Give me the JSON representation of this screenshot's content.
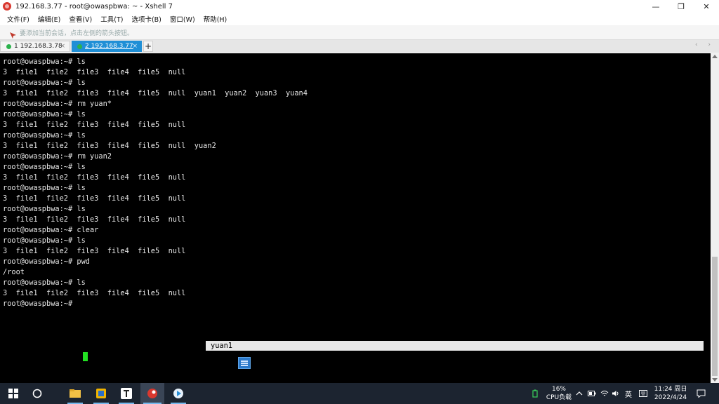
{
  "window": {
    "title": "192.168.3.77 - root@owaspbwa: ~ - Xshell 7",
    "controls": {
      "minimize": "—",
      "restore": "❐",
      "close": "✕"
    }
  },
  "menu": [
    "文件(F)",
    "编辑(E)",
    "查看(V)",
    "工具(T)",
    "选项卡(B)",
    "窗口(W)",
    "帮助(H)"
  ],
  "toolbar": {
    "tip": "要添加当前会话，点击左侧的箭头按钮。"
  },
  "tabs": [
    {
      "label": "1 192.168.3.78",
      "close": "×"
    },
    {
      "label": "2 192.168.3.77",
      "close": "×"
    }
  ],
  "tab_add": "+",
  "tab_nav": "‹ ›",
  "terminal": {
    "lines": [
      "root@owaspbwa:~# ls",
      "3  file1  file2  file3  file4  file5  null",
      "root@owaspbwa:~# ls",
      "3  file1  file2  file3  file4  file5  null  yuan1  yuan2  yuan3  yuan4",
      "root@owaspbwa:~# rm yuan*",
      "root@owaspbwa:~# ls",
      "3  file1  file2  file3  file4  file5  null",
      "root@owaspbwa:~# ls",
      "3  file1  file2  file3  file4  file5  null  yuan2",
      "root@owaspbwa:~# rm yuan2",
      "root@owaspbwa:~# ls",
      "3  file1  file2  file3  file4  file5  null",
      "root@owaspbwa:~# ls",
      "3  file1  file2  file3  file4  file5  null",
      "root@owaspbwa:~# ls",
      "3  file1  file2  file3  file4  file5  null",
      "root@owaspbwa:~# clear",
      "root@owaspbwa:~# ls",
      "3  file1  file2  file3  file4  file5  null",
      "root@owaspbwa:~# pwd",
      "/root",
      "root@owaspbwa:~# ls",
      "3  file1  file2  file3  file4  file5  null",
      "root@owaspbwa:~# "
    ],
    "highlighted": "yuan1",
    "cursor_color": "#22e022"
  },
  "taskbar": {
    "icons": [
      "windows-start-icon",
      "cortana-search-icon",
      "file-explorer-icon",
      "app-icon",
      "typora-icon",
      "xshell-icon",
      "media-player-icon"
    ],
    "cpu_percent": "16%",
    "cpu_label": "CPU负载",
    "ime": "英",
    "time": "11:24 周日",
    "date": "2022/4/24"
  },
  "colors": {
    "accent": "#1f8fd6",
    "terminal_bg": "#000000",
    "taskbar_bg": "#1c2430"
  }
}
